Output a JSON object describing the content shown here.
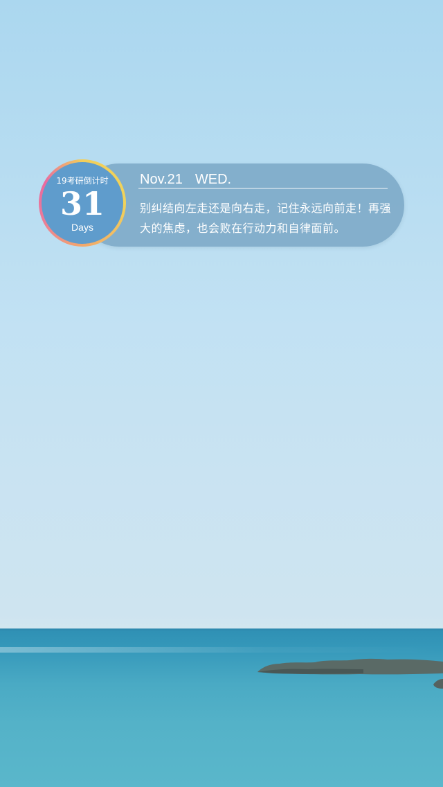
{
  "widget": {
    "countdown": {
      "caption": "19考研倒计时",
      "days": "31",
      "unit": "Days"
    },
    "date": "Nov.21",
    "weekday": "WED.",
    "quote": "别纠结向左走还是向右走，记住永远向前走！再强大的焦虑，也会败在行动力和自律面前。"
  },
  "colors": {
    "widget_background": "#78a5c3",
    "counter_fill": "#5f9ccc",
    "ring_gradient": [
      "#f3cf5a",
      "#f3a86c",
      "#e86aa0"
    ],
    "sky": "#b6dcf1",
    "sea": "#3598ba"
  }
}
